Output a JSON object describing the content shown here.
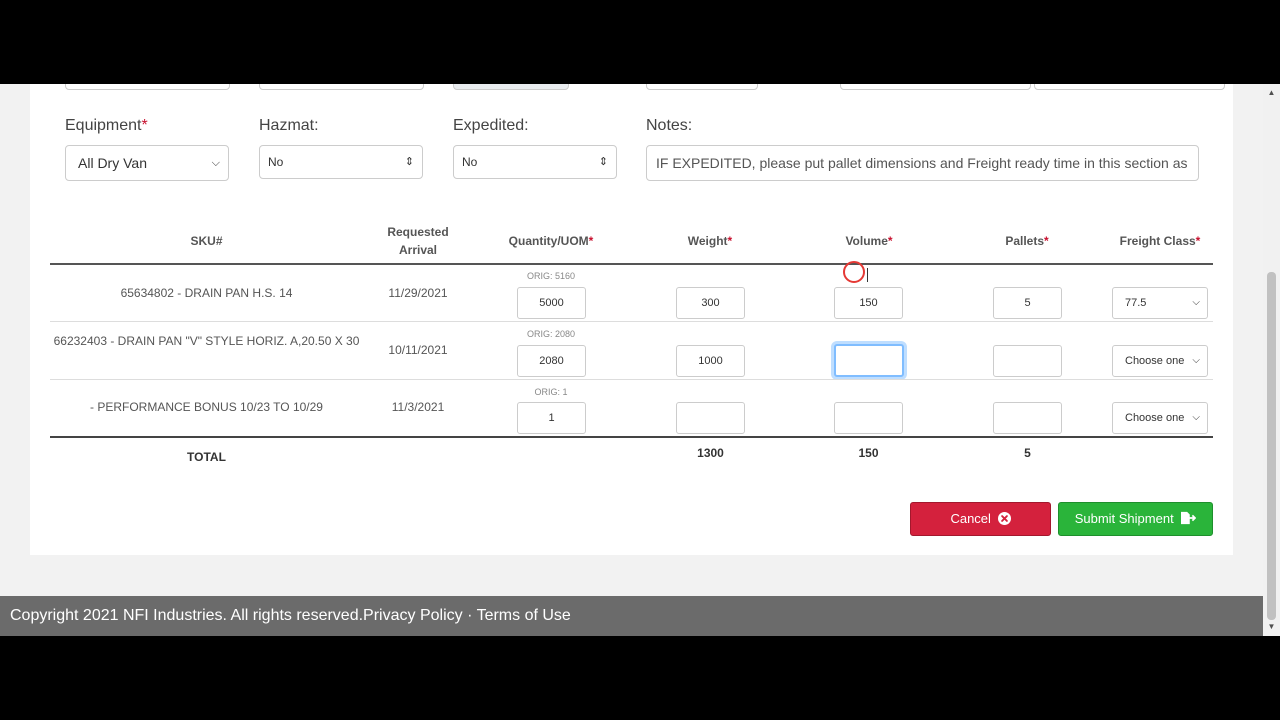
{
  "fields": {
    "equipment": {
      "label": "Equipment",
      "required_mark": "*",
      "value": "All Dry Van"
    },
    "hazmat": {
      "label": "Hazmat:",
      "value": "No"
    },
    "expedited": {
      "label": "Expedited:",
      "value": "No"
    },
    "notes": {
      "label": "Notes:",
      "value": "IF EXPEDITED, please put pallet dimensions and Freight ready time in this section as"
    }
  },
  "table": {
    "headers": {
      "sku": "SKU#",
      "requested_arrival": "Requested Arrival",
      "quantity": "Quantity/UOM",
      "weight": "Weight",
      "volume": "Volume",
      "pallets": "Pallets",
      "freight_class": "Freight Class",
      "required_mark": "*"
    },
    "rows": [
      {
        "sku": "65634802 - DRAIN PAN H.S. 14",
        "arrival": "11/29/2021",
        "orig": "ORIG: 5160",
        "quantity": "5000",
        "weight": "300",
        "volume": "150",
        "pallets": "5",
        "freight_class": "77.5"
      },
      {
        "sku": "66232403 - DRAIN PAN \"V\" STYLE HORIZ. A,20.50 X 30",
        "arrival": "10/11/2021",
        "orig": "ORIG: 2080",
        "quantity": "2080",
        "weight": "1000",
        "volume": "",
        "pallets": "",
        "freight_class": "Choose one"
      },
      {
        "sku": "- PERFORMANCE BONUS 10/23 TO 10/29",
        "arrival": "11/3/2021",
        "orig": "ORIG: 1",
        "quantity": "1",
        "weight": "",
        "volume": "",
        "pallets": "",
        "freight_class": "Choose one"
      }
    ],
    "total": {
      "label": "TOTAL",
      "weight": "1300",
      "volume": "150",
      "pallets": "5"
    }
  },
  "buttons": {
    "cancel": "Cancel",
    "submit": "Submit Shipment"
  },
  "footer": {
    "copyright": "Copyright 2021 NFI Industries. All rights reserved.",
    "privacy": "Privacy Policy",
    "separator": " · ",
    "terms": "Terms of Use"
  },
  "icons": {
    "cancel": "times-circle-icon",
    "submit": "file-export-icon"
  },
  "colors": {
    "cancel": "#d4213d",
    "submit": "#2ab43a",
    "required": "#c8102e",
    "footer": "#6b6b6b"
  }
}
